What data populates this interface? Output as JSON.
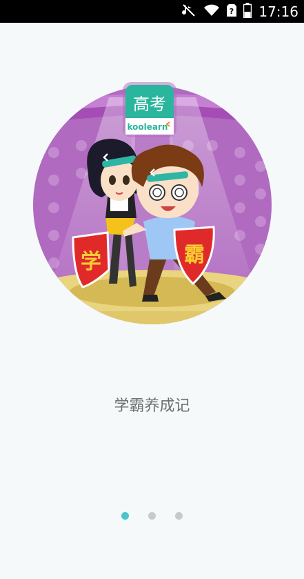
{
  "status_bar": {
    "time": "17:16",
    "icons": [
      "mute-icon",
      "wifi-icon",
      "sim-unknown-icon",
      "battery-icon"
    ]
  },
  "badge": {
    "title": "高考",
    "brand": "koolearn"
  },
  "illustration": {
    "shield_left": "学",
    "shield_right": "霸"
  },
  "caption": "学霸养成记",
  "pager": {
    "count": 3,
    "active_index": 0,
    "active_color": "#4cc4cc",
    "inactive_color": "#c9c9c9"
  },
  "colors": {
    "background": "#f5f9fa",
    "stage_purple": "#b06ac0",
    "badge_green": "#2ab59d"
  }
}
